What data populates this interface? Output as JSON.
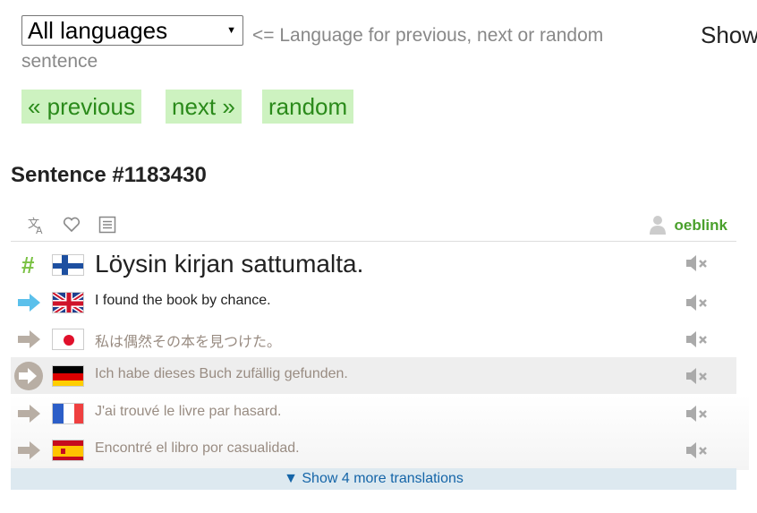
{
  "language_select": {
    "value": "All languages",
    "caret": "▼"
  },
  "hint": {
    "line1": "<= Language for previous, next or random",
    "line2": "sentence"
  },
  "show_cut": "Show",
  "nav": {
    "previous": "« previous",
    "next": "next »",
    "random": "random"
  },
  "sentence_title": "Sentence #1183430",
  "toolbar": {
    "owner": "oeblink"
  },
  "main_sentence": {
    "marker": "#",
    "text": "Löysin kirjan sattumalta.",
    "lang": "finnish"
  },
  "translations": [
    {
      "lang": "english",
      "text": "I found the book by chance.",
      "direct": true
    },
    {
      "lang": "japanese",
      "text": "私は偶然その本を見つけた。",
      "direct": false
    },
    {
      "lang": "german",
      "text": "Ich habe dieses Buch zufällig gefunden.",
      "direct": false,
      "highlight": true
    },
    {
      "lang": "french",
      "text": "J'ai trouvé le livre par hasard.",
      "direct": false
    },
    {
      "lang": "spanish",
      "text": "Encontré el libro por casualidad.",
      "direct": false
    }
  ],
  "more_translations": "▼ Show 4 more translations",
  "colors": {
    "green": "#4aa02c",
    "nav_bg": "#cdf2c0",
    "direct_arrow": "#5bc0eb",
    "indirect_arrow": "#b8aea4"
  }
}
